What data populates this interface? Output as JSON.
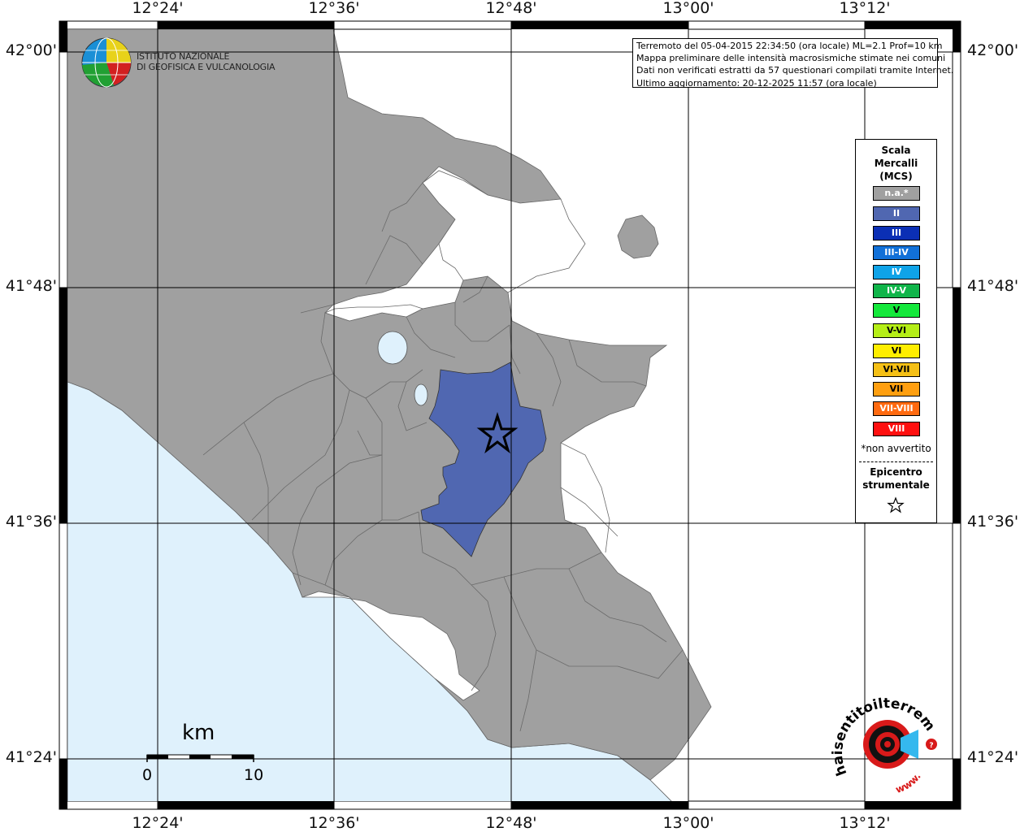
{
  "map": {
    "lon_ticks": [
      "12°24'",
      "12°36'",
      "12°48'",
      "13°00'",
      "13°12'"
    ],
    "lat_ticks": [
      "42°00'",
      "41°48'",
      "41°36'",
      "41°24'"
    ]
  },
  "info": {
    "lines": [
      "Terremoto del 05-04-2015 22:34:50 (ora locale) ML=2.1 Prof=10 km",
      "Mappa preliminare delle intensità macrosismiche stimate nei comuni",
      "Dati non verificati estratti da 57 questionari compilati tramite Internet.",
      "Ultimo aggiornamento: 20-12-2025 11:57 (ora locale)"
    ]
  },
  "institute": {
    "line1": "ISTITUTO NAZIONALE",
    "line2": "DI GEOFISICA E VULCANOLOGIA"
  },
  "legend": {
    "title": [
      "Scala",
      "Mercalli",
      "(MCS)"
    ],
    "items": [
      {
        "label": "n.a.*",
        "color": "#a0a0a0"
      },
      {
        "label": "II",
        "color": "#5067b1"
      },
      {
        "label": "III",
        "color": "#0b2fb5"
      },
      {
        "label": "III-IV",
        "color": "#1170d8"
      },
      {
        "label": "IV",
        "color": "#0fa3e8"
      },
      {
        "label": "IV-V",
        "color": "#10b54a"
      },
      {
        "label": "V",
        "color": "#14e83b"
      },
      {
        "label": "V-VI",
        "color": "#b5ee16"
      },
      {
        "label": "VI",
        "color": "#ffee00"
      },
      {
        "label": "VI-VII",
        "color": "#f5c016"
      },
      {
        "label": "VII",
        "color": "#ff9f10"
      },
      {
        "label": "VII-VIII",
        "color": "#ff6a10"
      },
      {
        "label": "VIII",
        "color": "#ff1010"
      }
    ],
    "note": "*non avvertito",
    "epicenter": [
      "Epicentro",
      "strumentale"
    ]
  },
  "scale_bar": {
    "unit": "km",
    "min_label": "0",
    "max_label": "10"
  },
  "colors": {
    "sea": "#dff1fc",
    "land": "#a0a0a0",
    "intensity_II": "#5067b1"
  },
  "logo_text": {
    "ring": "haisentitoilterremoto.it",
    "www": "www."
  }
}
